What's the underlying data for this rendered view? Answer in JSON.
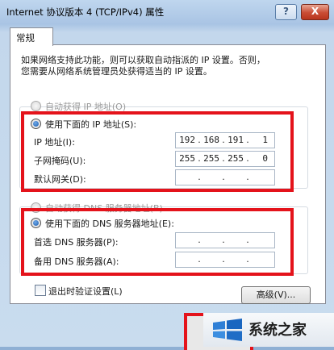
{
  "window": {
    "title": "Internet 协议版本 4 (TCP/IPv4) 属性",
    "help_glyph": "?",
    "close_glyph": "X"
  },
  "tab": {
    "label": "常规"
  },
  "description": [
    "如果网络支持此功能，则可以获取自动指派的 IP 设置。否则，",
    "您需要从网络系统管理员处获得适当的 IP 设置。"
  ],
  "ip": {
    "auto_label": "自动获得 IP 地址(O)",
    "manual_label": "使用下面的 IP 地址(S):",
    "selected": "manual",
    "address_label": "IP 地址(I):",
    "address": [
      "192",
      "168",
      "191",
      "1"
    ],
    "subnet_label": "子网掩码(U):",
    "subnet": [
      "255",
      "255",
      "255",
      "0"
    ],
    "gateway_label": "默认网关(D):",
    "gateway": [
      "",
      "",
      "",
      ""
    ]
  },
  "dns": {
    "auto_label": "自动获得 DNS 服务器地址(B)",
    "manual_label": "使用下面的 DNS 服务器地址(E):",
    "selected": "manual",
    "preferred_label": "首选 DNS 服务器(P):",
    "preferred": [
      "",
      "",
      "",
      ""
    ],
    "alternate_label": "备用 DNS 服务器(A):",
    "alternate": [
      "",
      "",
      "",
      ""
    ]
  },
  "validate_on_exit": {
    "label": "退出时验证设置(L)",
    "checked": false
  },
  "advanced_button": "高级(V)...",
  "watermark": {
    "text": "系统之家",
    "icon": "windows-logo-icon"
  },
  "colors": {
    "highlight": "#e4131b",
    "radio_selected": "#1f5fb0"
  }
}
